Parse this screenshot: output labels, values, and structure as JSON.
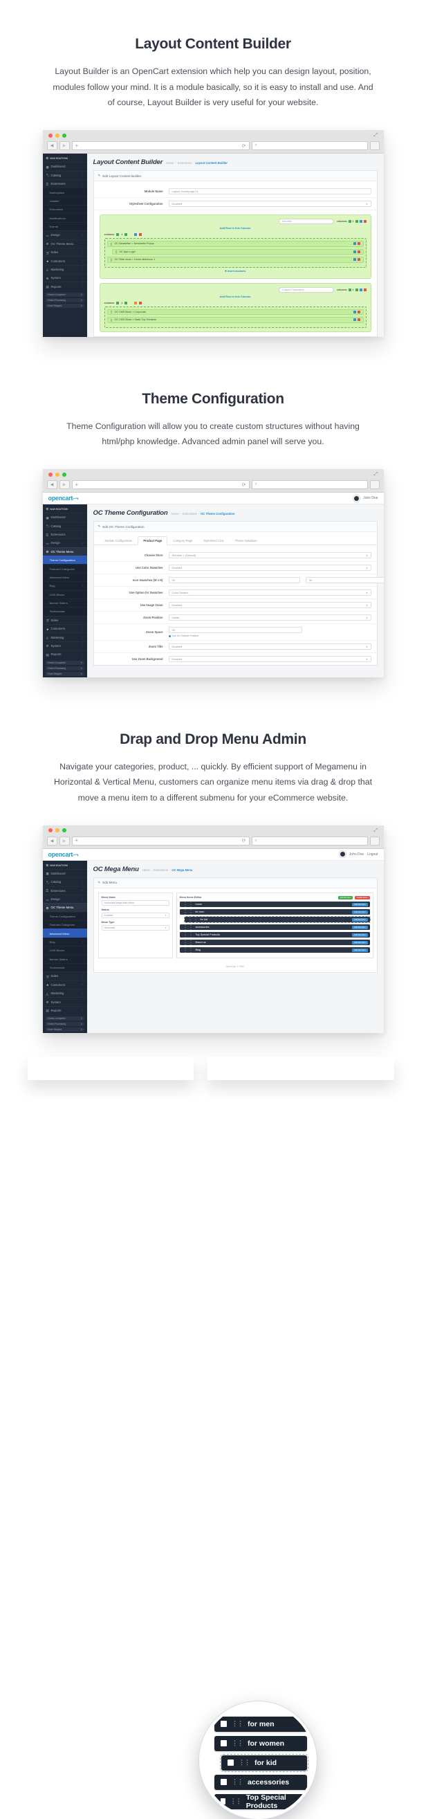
{
  "sections": [
    {
      "title": "Layout Content Builder",
      "desc": "Layout Builder is an OpenCart extension which help you can design layout, position, modules follow your mind. It is a module basically, so it is easy to install and use. And of course, Layout Builder is very useful for your website."
    },
    {
      "title": "Theme Configuration",
      "desc": "Theme Configuration will allow you to create custom structures without having html/php knowledge. Advanced admin panel will serve you."
    },
    {
      "title": "Drap and Drop Menu Admin",
      "desc": "Navigate your categories, product, ... quickly. By efficient support of Megamenu in Horizontal & Vertical Menu, customers can organize menu items via drag & drop that move a menu item to a different submenu for your eCommerce website."
    }
  ],
  "browser": {
    "back_icon": "◀",
    "forward_icon": "▶",
    "plus_icon": "+",
    "reload_icon": "⟳",
    "search_icon": "🔍",
    "expand_icon": "⤢",
    "url_value": "",
    "search_value": ""
  },
  "mock1": {
    "page_title": "Layout Content Builder",
    "breadcrumbs": [
      "Home",
      "Extensions",
      "Layout Content Builder"
    ],
    "panel_head": "Edit Layout Content Builder",
    "nav_header": "NAVIGATION",
    "nav_items": [
      {
        "label": "Dashboard",
        "icon": "dashboard-icon",
        "caret": false
      },
      {
        "label": "Catalog",
        "icon": "tag-icon",
        "caret": true
      },
      {
        "label": "Extensions",
        "icon": "puzzle-icon",
        "caret": true
      },
      {
        "label": "Marketplace",
        "icon": "dot-icon",
        "caret": false,
        "sub": true
      },
      {
        "label": "Installer",
        "icon": "dot-icon",
        "caret": false,
        "sub": true
      },
      {
        "label": "Extensions",
        "icon": "dot-icon",
        "caret": false,
        "sub": true
      },
      {
        "label": "Modifications",
        "icon": "dot-icon",
        "caret": false,
        "sub": true
      },
      {
        "label": "Events",
        "icon": "dot-icon",
        "caret": false,
        "sub": true
      },
      {
        "label": "Design",
        "icon": "monitor-icon",
        "caret": true
      },
      {
        "label": "OC Theme Menu",
        "icon": "gear-icon",
        "caret": true
      },
      {
        "label": "Sales",
        "icon": "cart-icon",
        "caret": true
      },
      {
        "label": "Customers",
        "icon": "user-icon",
        "caret": true
      },
      {
        "label": "Marketing",
        "icon": "megaphone-icon",
        "caret": true
      },
      {
        "label": "System",
        "icon": "cog-icon",
        "caret": true
      },
      {
        "label": "Reports",
        "icon": "chart-icon",
        "caret": true
      }
    ],
    "sidebar_foot": [
      {
        "label": "Orders Completed",
        "value": "0"
      },
      {
        "label": "Orders Processing",
        "value": "0"
      },
      {
        "label": "Order Shipped",
        "value": "0"
      }
    ],
    "form": [
      {
        "label": "Module Name",
        "value": "Layout Homepage 01",
        "type": "text"
      },
      {
        "label": "Stylesheet Configuration",
        "value": "Enabled",
        "type": "select"
      }
    ],
    "blocks": [
      {
        "classname_placeholder": "full-width",
        "meta_label": "columns",
        "meta_count": "1",
        "add_row_label": "Add Row in this Column",
        "cols_label": "columns",
        "cols_count": "1",
        "modules": [
          {
            "label": "OC Newsletter > Newsletter Popup",
            "indent": false
          },
          {
            "label": "OC Ajax Login",
            "indent": true
          },
          {
            "label": "OC Slide show > Home slideshow 1",
            "indent": false
          }
        ],
        "insert_label": "Insert modules"
      },
      {
        "classname_placeholder": "Custom Classname",
        "meta_label": "columns",
        "meta_count": "1",
        "add_row_label": "Add Row in this Column",
        "cols_label": "columns",
        "cols_count": "1",
        "modules": [
          {
            "label": "OC CMS Block > Corporate",
            "indent": false
          },
          {
            "label": "OC CMS Block > Static Top Greatest",
            "indent": false
          }
        ],
        "insert_label": "Insert modules"
      }
    ]
  },
  "mock2": {
    "logo": "opencart",
    "user_label": "John Doe",
    "page_title": "OC Theme Configuration",
    "breadcrumbs": [
      "Home",
      "Extensions",
      "OC Theme Configuration"
    ],
    "panel_head": "Edit OC Theme Configuration",
    "nav_header": "NAVIGATION",
    "tabs": [
      {
        "label": "Module Configuration",
        "active": false
      },
      {
        "label": "Product Page",
        "active": true
      },
      {
        "label": "Category Page",
        "active": false
      },
      {
        "label": "Stylesheet CSS",
        "active": false
      },
      {
        "label": "Theme Database",
        "active": false
      }
    ],
    "nav_items": [
      {
        "label": "Dashboard",
        "icon": "dashboard-icon",
        "caret": false
      },
      {
        "label": "Catalog",
        "icon": "tag-icon",
        "caret": true
      },
      {
        "label": "Extensions",
        "icon": "puzzle-icon",
        "caret": true
      },
      {
        "label": "Design",
        "icon": "monitor-icon",
        "caret": true
      },
      {
        "label": "OC Theme Menu",
        "icon": "gear-icon",
        "caret": true,
        "active": true
      },
      {
        "label": "Theme Configuration",
        "icon": "dot-icon",
        "sub": true,
        "subactive": true
      },
      {
        "label": "Featured Categories",
        "icon": "dot-icon",
        "sub": true
      },
      {
        "label": "Advanced Menu",
        "icon": "dot-icon",
        "sub": true
      },
      {
        "label": "Blog",
        "icon": "dot-icon",
        "sub": true,
        "caret": true
      },
      {
        "label": "CMS Blocks",
        "icon": "dot-icon",
        "sub": true
      },
      {
        "label": "Banner Sliders",
        "icon": "dot-icon",
        "sub": true
      },
      {
        "label": "Testimonials",
        "icon": "dot-icon",
        "sub": true
      },
      {
        "label": "Sales",
        "icon": "cart-icon",
        "caret": true
      },
      {
        "label": "Customers",
        "icon": "user-icon",
        "caret": true
      },
      {
        "label": "Marketing",
        "icon": "megaphone-icon",
        "caret": true
      },
      {
        "label": "System",
        "icon": "cog-icon",
        "caret": true
      },
      {
        "label": "Reports",
        "icon": "chart-icon",
        "caret": true
      }
    ],
    "sidebar_foot": [
      {
        "label": "Orders Completed",
        "value": "0"
      },
      {
        "label": "Orders Processing",
        "value": "0"
      },
      {
        "label": "Order Shipped",
        "value": "0"
      }
    ],
    "form": [
      {
        "label": "Choose Store",
        "value": "Sneaker 1 (Default)",
        "type": "select"
      },
      {
        "label": "Use Color Swatches",
        "value": "Enabled",
        "type": "select"
      },
      {
        "label": "Icon Swatches (W x H)",
        "value": "30",
        "value2": "30",
        "type": "double"
      },
      {
        "label": "Use Option for Swatches",
        "value": "Color Swatch",
        "type": "select"
      },
      {
        "label": "Use Image Zoom",
        "value": "Enabled",
        "type": "select"
      },
      {
        "label": "Zoom Position",
        "value": "Inside",
        "type": "select"
      },
      {
        "label": "Zoom Space",
        "value": "30",
        "type": "text",
        "radio": "Use for Outside Position"
      },
      {
        "label": "Zoom Title",
        "value": "Enabled",
        "type": "select"
      },
      {
        "label": "Use Zoom Background",
        "value": "Enabled",
        "type": "select"
      }
    ]
  },
  "mock3": {
    "logo": "opencart",
    "user_label": "John Doe",
    "logout_label": "Logout",
    "page_title": "OC Mega Menu",
    "breadcrumbs": [
      "Home",
      "Extensions",
      "OC Mega Menu"
    ],
    "panel_head": "Edit Menu",
    "nav_header": "NAVIGATION",
    "nav_items": [
      {
        "label": "Dashboard",
        "icon": "dashboard-icon",
        "caret": false
      },
      {
        "label": "Catalog",
        "icon": "tag-icon",
        "caret": true
      },
      {
        "label": "Extensions",
        "icon": "puzzle-icon",
        "caret": true
      },
      {
        "label": "Design",
        "icon": "monitor-icon",
        "caret": true
      },
      {
        "label": "OC Theme Menu",
        "icon": "gear-icon",
        "caret": true,
        "active": true
      },
      {
        "label": "Theme Configuration",
        "icon": "dot-icon",
        "sub": true
      },
      {
        "label": "Featured Categories",
        "icon": "dot-icon",
        "sub": true
      },
      {
        "label": "Advanced Menu",
        "icon": "dot-icon",
        "sub": true,
        "subactive": true
      },
      {
        "label": "Blog",
        "icon": "dot-icon",
        "sub": true,
        "caret": true
      },
      {
        "label": "CMS Blocks",
        "icon": "dot-icon",
        "sub": true
      },
      {
        "label": "Banner Sliders",
        "icon": "dot-icon",
        "sub": true
      },
      {
        "label": "Testimonials",
        "icon": "dot-icon",
        "sub": true
      },
      {
        "label": "Sales",
        "icon": "cart-icon",
        "caret": true
      },
      {
        "label": "Customers",
        "icon": "user-icon",
        "caret": true
      },
      {
        "label": "Marketing",
        "icon": "megaphone-icon",
        "caret": true
      },
      {
        "label": "System",
        "icon": "cog-icon",
        "caret": true
      },
      {
        "label": "Reports",
        "icon": "chart-icon",
        "caret": true
      }
    ],
    "sidebar_foot": [
      {
        "label": "Orders Completed",
        "value": "0"
      },
      {
        "label": "Orders Processing",
        "value": "0"
      },
      {
        "label": "Order Shipped",
        "value": "0"
      }
    ],
    "left_panel": {
      "menu_name_label": "Menu Name",
      "menu_name_value": "Horizontal Mega Main Menu",
      "status_label": "Status",
      "status_value": "Enabled",
      "menu_type_label": "Menu Type",
      "menu_type_value": "Horizontal"
    },
    "editor_title": "Menu Items Editor",
    "editor_buttons": [
      "Add Top Item",
      "Delete Items"
    ],
    "row_button": "Add Sub Item",
    "menu_items": [
      {
        "label": "home"
      },
      {
        "label": "for men"
      },
      {
        "label": "for kid"
      },
      {
        "label": "accessories"
      },
      {
        "label": "Top Special Products"
      },
      {
        "label": "Brand us"
      },
      {
        "label": "Blog"
      }
    ],
    "footer_text": "OpenCart © 2020",
    "magnified_items": [
      {
        "label": "for men",
        "dashed": false
      },
      {
        "label": "for women",
        "dashed": false
      },
      {
        "label": "for kid",
        "dashed": true
      },
      {
        "label": "accessories",
        "dashed": false
      },
      {
        "label": "Top Special Products",
        "dashed": false
      }
    ]
  },
  "colors": {
    "accent": "#1d8fd1",
    "sidebar": "#1f2836",
    "green_block": "#ddf5c0",
    "brand": "#229ac8"
  }
}
